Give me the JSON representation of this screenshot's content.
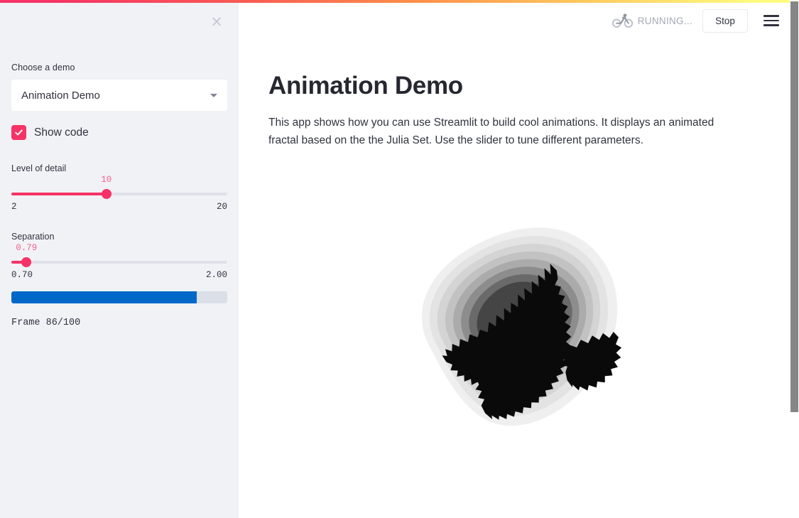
{
  "theme": {
    "primary": "#f63366",
    "sidebar_bg": "#f0f2f6",
    "progress_blue": "#0068c9",
    "text": "#31333f",
    "gradient_start": "#f63366",
    "gradient_end": "#fffc7f"
  },
  "sidebar": {
    "close_label": "×",
    "demo_label": "Choose a demo",
    "demo_selected": "Animation Demo",
    "checkbox": {
      "label": "Show code",
      "checked": true
    },
    "sliders": [
      {
        "name": "level-of-detail",
        "title": "Level of detail",
        "value": "10",
        "min": "2",
        "max": "20",
        "percent": 44
      },
      {
        "name": "separation",
        "title": "Separation",
        "value": "0.79",
        "min": "0.70",
        "max": "2.00",
        "percent": 7
      }
    ],
    "progress": {
      "percent": 86,
      "frame_text": "Frame 86/100"
    }
  },
  "header": {
    "status_text": "RUNNING...",
    "status_icon": "bicycle-icon",
    "stop_label": "Stop",
    "menu_icon": "hamburger-menu-icon"
  },
  "main": {
    "title": "Animation Demo",
    "description": "This app shows how you can use Streamlit to build cool animations. It displays an animated fractal based on the the Julia Set. Use the slider to tune different parameters.",
    "fractal_alt": "julia-set-fractal"
  }
}
